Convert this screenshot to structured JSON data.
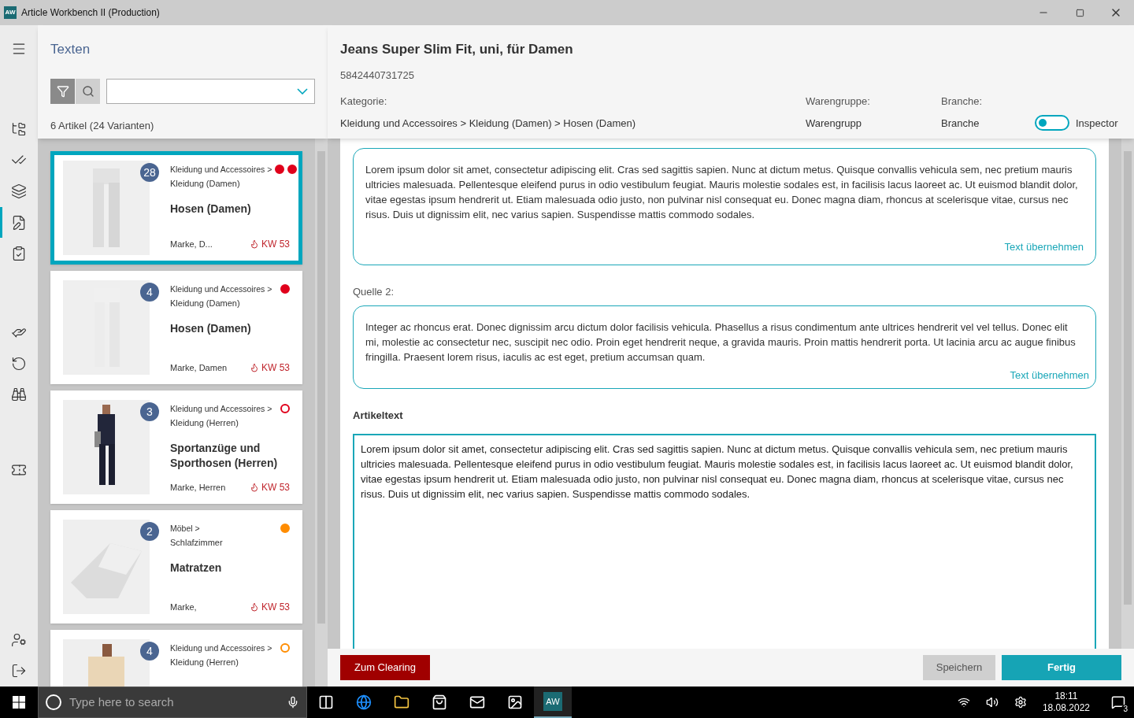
{
  "window": {
    "app_badge": "AW",
    "title": "Article Workbench II (Production)"
  },
  "nav_items": [
    {
      "selected": false
    },
    {
      "selected": false
    },
    {
      "selected": false
    },
    {
      "selected": true
    },
    {
      "selected": false
    },
    {
      "selected": false
    },
    {
      "selected": false
    },
    {
      "selected": false
    },
    {
      "selected": false
    },
    {
      "selected": false
    },
    {
      "selected": false
    }
  ],
  "list_panel": {
    "title": "Texten",
    "filter_buttons": [
      {
        "selected": true
      },
      {
        "selected": false
      }
    ],
    "count": "6 Artikel (24 Varianten)"
  },
  "cards": [
    {
      "selected": true,
      "count": "28",
      "category": "Kleidung und Accessoires >",
      "subcategory": "Kleidung (Damen)",
      "title": "Hosen (Damen)",
      "brand": "Marke, D...",
      "week": "KW 53",
      "markers": [
        {
          "color": "#e0001b",
          "filled": true
        },
        {
          "color": "#e0001b",
          "filled": true
        }
      ]
    },
    {
      "selected": false,
      "count": "4",
      "category": "Kleidung und Accessoires >",
      "subcategory": "Kleidung (Damen)",
      "title": "Hosen (Damen)",
      "brand": "Marke, Damen",
      "week": "KW 53",
      "markers": [
        {
          "color": "#e0001b",
          "filled": true
        }
      ]
    },
    {
      "selected": false,
      "count": "3",
      "category": "Kleidung und Accessoires >",
      "subcategory": "Kleidung (Herren)",
      "title": "Sportanzüge und Sporthosen (Herren)",
      "brand": "Marke, Herren",
      "week": "KW 53",
      "markers": [
        {
          "color": "#e0001b",
          "filled": false
        }
      ]
    },
    {
      "selected": false,
      "count": "2",
      "category": "Möbel >",
      "subcategory": "Schlafzimmer",
      "title": "Matratzen",
      "brand": "Marke,",
      "week": "KW 53",
      "markers": [
        {
          "color": "#ff8c00",
          "filled": true
        }
      ]
    },
    {
      "selected": false,
      "count": "4",
      "category": "Kleidung und Accessoires >",
      "subcategory": "Kleidung (Herren)",
      "markers": [
        {
          "color": "#ff8c00",
          "filled": false
        }
      ]
    }
  ],
  "article": {
    "title": "Jeans Super Slim Fit, uni, für Damen",
    "ean": "5842440731725",
    "category_label": "Kategorie:",
    "category": "Kleidung und Accessoires > Kleidung (Damen) > Hosen (Damen)",
    "group_label": "Warengruppe:",
    "group": "Warengrupp",
    "branch_label": "Branche:",
    "branch": "Branche",
    "inspector": {
      "label": "Inspector",
      "on": false
    }
  },
  "sources": [
    {
      "text": "Lorem ipsum dolor sit amet, consectetur adipiscing elit. Cras sed sagittis sapien. Nunc at dictum metus. Quisque convallis vehicula sem, nec pretium mauris ultricies malesuada. Pellentesque eleifend purus in odio vestibulum feugiat. Mauris molestie sodales est, in facilisis lacus laoreet ac. Ut euismod blandit dolor, vitae egestas ipsum hendrerit ut. Etiam malesuada odio justo, non pulvinar nisl consequat eu. Donec magna diam, rhoncus at scelerisque vitae, cursus nec risus. Duis ut dignissim elit, nec varius sapien. Suspendisse mattis commodo sodales.",
      "action": "Text übernehmen"
    },
    {
      "label": "Quelle 2:",
      "text": "Integer ac rhoncus erat. Donec dignissim arcu dictum dolor facilisis vehicula. Phasellus a risus condimentum ante ultrices hendrerit vel vel tellus. Donec elit mi, molestie ac consectetur nec, suscipit nec odio. Proin eget hendrerit neque, a gravida mauris. Proin mattis hendrerit porta. Ut lacinia arcu ac augue finibus fringilla. Praesent lorem risus, iaculis ac est eget, pretium accumsan quam.",
      "action": "Text übernehmen"
    }
  ],
  "article_text": {
    "label": "Artikeltext",
    "value": "Lorem ipsum dolor sit amet, consectetur adipiscing elit. Cras sed sagittis sapien. Nunc at dictum metus. Quisque convallis vehicula sem, nec pretium mauris ultricies malesuada. Pellentesque eleifend purus in odio vestibulum feugiat. Mauris molestie sodales est, in facilisis lacus laoreet ac. Ut euismod blandit dolor, vitae egestas ipsum hendrerit ut. Etiam malesuada odio justo, non pulvinar nisl consequat eu. Donec magna diam, rhoncus at scelerisque vitae, cursus nec risus. Duis ut dignissim elit, nec varius sapien. Suspendisse mattis commodo sodales."
  },
  "footer": {
    "clearing": "Zum Clearing",
    "save": "Speichern",
    "done": "Fertig"
  },
  "taskbar": {
    "search_placeholder": "Type here to search",
    "app_badge": "AW",
    "time": "18:11",
    "date": "18.08.2022",
    "notifications": "3"
  }
}
